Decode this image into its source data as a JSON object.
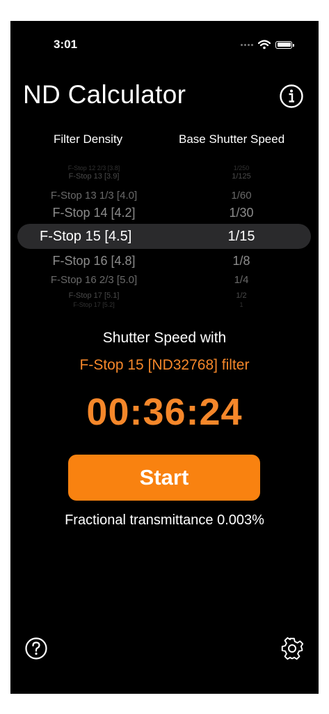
{
  "status_bar": {
    "time": "3:01"
  },
  "app": {
    "title": "ND Calculator"
  },
  "picker": {
    "density_header": "Filter Density",
    "shutter_header": "Base Shutter Speed",
    "rows": [
      {
        "density": "F-Stop 12 2/3 [3.8]",
        "shutter": "1/250"
      },
      {
        "density": "F-Stop 13 [3.9]",
        "shutter": "1/125"
      },
      {
        "density": "F-Stop 13 1/3 [4.0]",
        "shutter": "1/60"
      },
      {
        "density": "F-Stop 14 [4.2]",
        "shutter": "1/30"
      },
      {
        "density": "F-Stop 15 [4.5]",
        "shutter": "1/15"
      },
      {
        "density": "F-Stop 16 [4.8]",
        "shutter": "1/8"
      },
      {
        "density": "F-Stop 16 2/3 [5.0]",
        "shutter": "1/4"
      },
      {
        "density": "F-Stop 17 [5.1]",
        "shutter": "1/2"
      },
      {
        "density": "F-Stop 17 [5.2]",
        "shutter": "1"
      }
    ]
  },
  "result": {
    "shutter_label": "Shutter Speed with",
    "filter_label": "F-Stop 15 [ND32768] filter",
    "timer": "00:36:24",
    "start_label": "Start",
    "transmittance": "Fractional transmittance 0.003%"
  },
  "colors": {
    "accent": "#F5872A",
    "button": "#F98210",
    "background": "#000000"
  },
  "icons": {
    "info": "info-circle-icon",
    "help": "question-circle-icon",
    "settings": "gear-icon",
    "wifi": "wifi-icon",
    "battery": "battery-icon"
  }
}
